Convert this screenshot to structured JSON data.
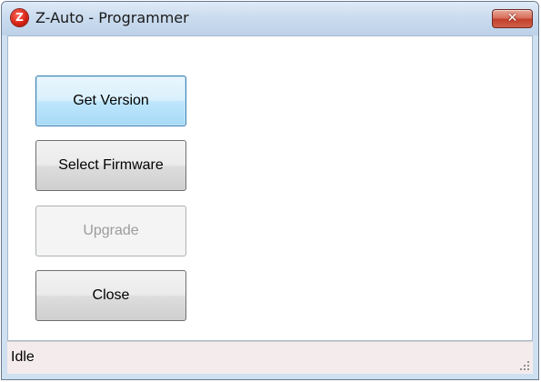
{
  "window": {
    "title": "Z-Auto - Programmer",
    "icon_letter": "Z",
    "icon": "app-logo-icon",
    "close_glyph": "✕"
  },
  "buttons": {
    "get_version": "Get Version",
    "select_firmware": "Select Firmware",
    "upgrade": "Upgrade",
    "close": "Close"
  },
  "button_states": {
    "get_version": "focused",
    "select_firmware": "enabled",
    "upgrade": "disabled",
    "close": "enabled"
  },
  "statusbar": {
    "text": "Idle"
  },
  "colors": {
    "title_bar": "#cbdcef",
    "close_button": "#c2402c",
    "focus_border": "#3c7fb1",
    "status_bar": "#f4ecec"
  }
}
